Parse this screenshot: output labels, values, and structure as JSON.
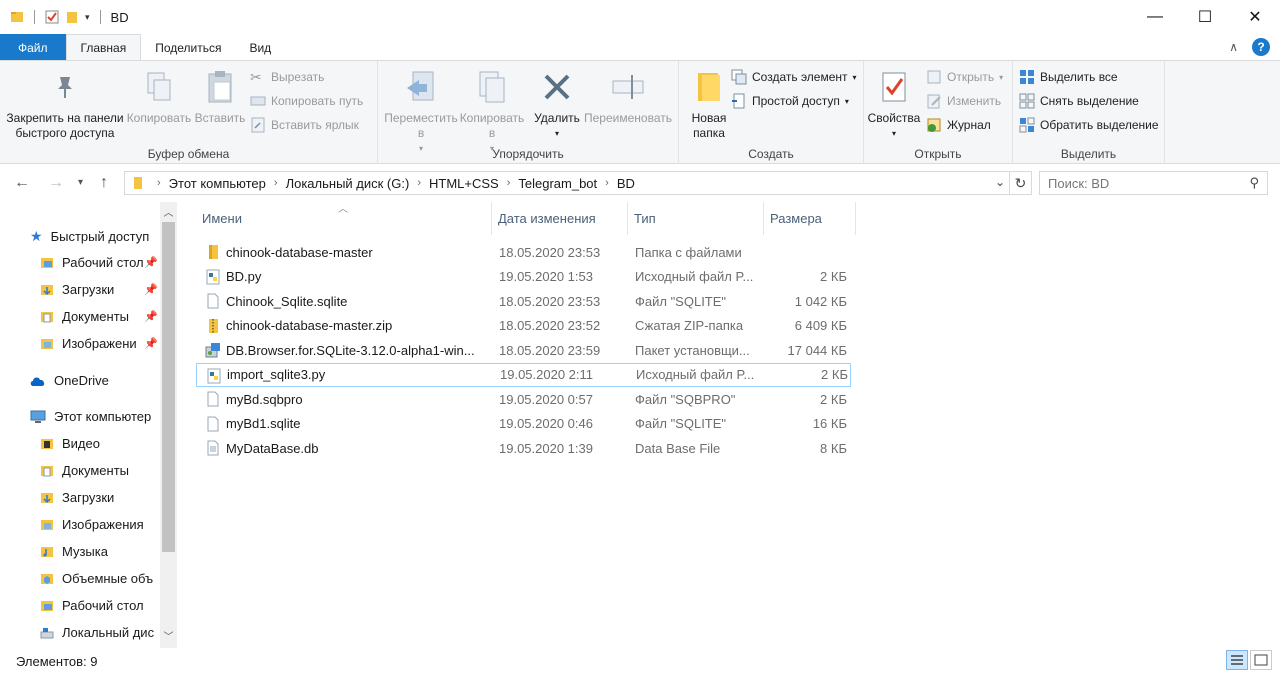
{
  "window": {
    "title": "BD",
    "controls": {
      "minimize": "—",
      "maximize": "☐",
      "close": "✕"
    }
  },
  "ribbon_tabs": [
    {
      "label": "Файл"
    },
    {
      "label": "Главная"
    },
    {
      "label": "Поделиться"
    },
    {
      "label": "Вид"
    }
  ],
  "ribbon": {
    "clipboard": {
      "label": "Буфер обмена",
      "pin": "Закрепить на панели быстрого доступа",
      "copy": "Копировать",
      "paste": "Вставить",
      "cut": "Вырезать",
      "copy_path": "Копировать путь",
      "paste_shortcut": "Вставить ярлык"
    },
    "organize": {
      "label": "Упорядочить",
      "move": "Переместить в",
      "copy_to": "Копировать в",
      "delete": "Удалить",
      "rename": "Переименовать"
    },
    "new": {
      "label": "Создать",
      "new_folder": "Новая папка",
      "new_item": "Создать элемент",
      "easy_access": "Простой доступ"
    },
    "open": {
      "label": "Открыть",
      "properties": "Свойства",
      "open": "Открыть",
      "edit": "Изменить",
      "history": "Журнал"
    },
    "select": {
      "label": "Выделить",
      "select_all": "Выделить все",
      "select_none": "Снять выделение",
      "invert": "Обратить выделение"
    }
  },
  "address": {
    "crumbs": [
      "Этот компьютер",
      "Локальный диск (G:)",
      "HTML+CSS",
      "Telegram_bot",
      "BD"
    ],
    "search_placeholder": "Поиск: BD"
  },
  "nav": {
    "quick_access": "Быстрый доступ",
    "quick_items": [
      "Рабочий стол",
      "Загрузки",
      "Документы",
      "Изображени"
    ],
    "onedrive": "OneDrive",
    "this_pc": "Этот компьютер",
    "pc_items": [
      "Видео",
      "Документы",
      "Загрузки",
      "Изображения",
      "Музыка",
      "Объемные объ",
      "Рабочий стол",
      "Локальный дис"
    ]
  },
  "columns": {
    "name": "Имени",
    "date": "Дата изменения",
    "type": "Тип",
    "size": "Размера"
  },
  "files": [
    {
      "name": "chinook-database-master",
      "date": "18.05.2020 23:53",
      "type": "Папка с файлами",
      "size": "",
      "icon": "folder-icon"
    },
    {
      "name": "BD.py",
      "date": "19.05.2020 1:53",
      "type": "Исходный файл P...",
      "size": "2 КБ",
      "icon": "python-file-icon"
    },
    {
      "name": "Chinook_Sqlite.sqlite",
      "date": "18.05.2020 23:53",
      "type": "Файл \"SQLITE\"",
      "size": "1 042 КБ",
      "icon": "file-icon"
    },
    {
      "name": "chinook-database-master.zip",
      "date": "18.05.2020 23:52",
      "type": "Сжатая ZIP-папка",
      "size": "6 409 КБ",
      "icon": "zip-folder-icon"
    },
    {
      "name": "DB.Browser.for.SQLite-3.12.0-alpha1-win...",
      "date": "18.05.2020 23:59",
      "type": "Пакет установщи...",
      "size": "17 044 КБ",
      "icon": "installer-icon"
    },
    {
      "name": "import_sqlite3.py",
      "date": "19.05.2020 2:11",
      "type": "Исходный файл P...",
      "size": "2 КБ",
      "icon": "python-file-icon"
    },
    {
      "name": "myBd.sqbpro",
      "date": "19.05.2020 0:57",
      "type": "Файл \"SQBPRO\"",
      "size": "2 КБ",
      "icon": "file-icon"
    },
    {
      "name": "myBd1.sqlite",
      "date": "19.05.2020 0:46",
      "type": "Файл \"SQLITE\"",
      "size": "16 КБ",
      "icon": "file-icon"
    },
    {
      "name": "MyDataBase.db",
      "date": "19.05.2020 1:39",
      "type": "Data Base File",
      "size": "8 КБ",
      "icon": "db-file-icon"
    }
  ],
  "selected_row": 5,
  "status": {
    "items_count": "Элементов: 9"
  },
  "colors": {
    "accent": "#1979ca",
    "selection_border": "#99d1ff",
    "folder": "#f5c342"
  }
}
